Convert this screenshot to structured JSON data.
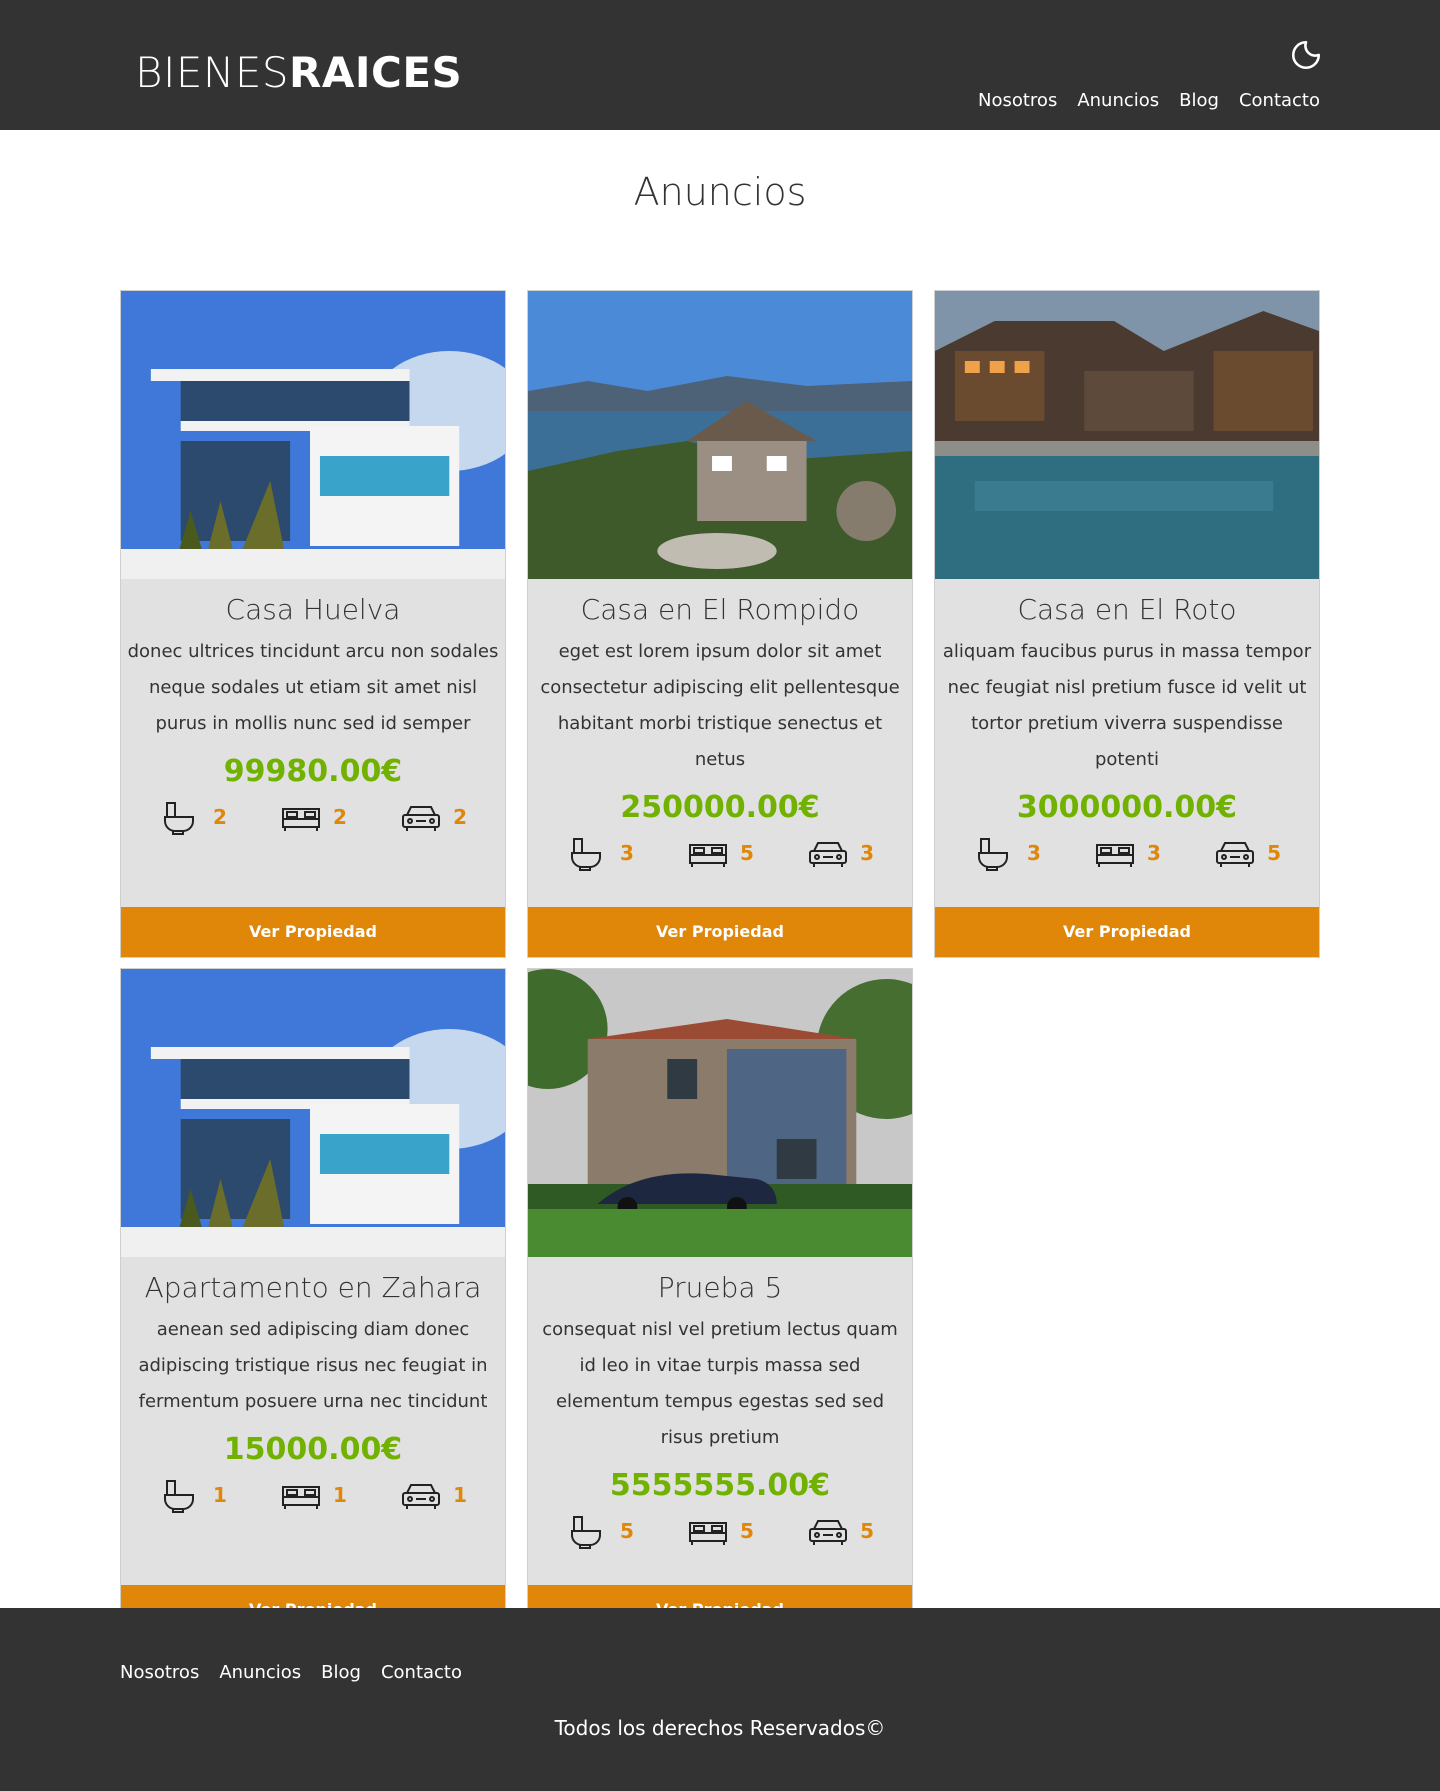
{
  "header": {
    "logo_light": "BIENES",
    "logo_bold": "RAICES",
    "nav": [
      {
        "label": "Nosotros"
      },
      {
        "label": "Anuncios"
      },
      {
        "label": "Blog"
      },
      {
        "label": "Contacto"
      }
    ]
  },
  "main": {
    "title": "Anuncios",
    "listings": [
      {
        "title": "Casa Huelva",
        "description": "donec ultrices tincidunt arcu non sodales neque sodales ut etiam sit amet nisl purus in mollis nunc sed id semper",
        "price": "99980.00€",
        "bathrooms": "2",
        "bedrooms": "2",
        "parking": "2",
        "button": "Ver Propiedad"
      },
      {
        "title": "Casa en El Rompido",
        "description": "eget est lorem ipsum dolor sit amet consectetur adipiscing elit pellentesque habitant morbi tristique senectus et netus",
        "price": "250000.00€",
        "bathrooms": "3",
        "bedrooms": "5",
        "parking": "3",
        "button": "Ver Propiedad"
      },
      {
        "title": "Casa en El Roto",
        "description": "aliquam faucibus purus in massa tempor nec feugiat nisl pretium fusce id velit ut tortor pretium viverra suspendisse potenti",
        "price": "3000000.00€",
        "bathrooms": "3",
        "bedrooms": "3",
        "parking": "5",
        "button": "Ver Propiedad"
      },
      {
        "title": "Apartamento en Zahara",
        "description": "aenean sed adipiscing diam donec adipiscing tristique risus nec feugiat in fermentum posuere urna nec tincidunt",
        "price": "15000.00€",
        "bathrooms": "1",
        "bedrooms": "1",
        "parking": "1",
        "button": "Ver Propiedad"
      },
      {
        "title": "Prueba 5",
        "description": "consequat nisl vel pretium lectus quam id leo in vitae turpis massa sed elementum tempus egestas sed sed risus pretium",
        "price": "5555555.00€",
        "bathrooms": "5",
        "bedrooms": "5",
        "parking": "5",
        "button": "Ver Propiedad"
      }
    ]
  },
  "footer": {
    "nav": [
      {
        "label": "Nosotros"
      },
      {
        "label": "Anuncios"
      },
      {
        "label": "Blog"
      },
      {
        "label": "Contacto"
      }
    ],
    "copyright": "Todos los derechos Reservados©"
  },
  "colors": {
    "header_bg": "#333333",
    "card_bg": "#e1e1e1",
    "price_green": "#71b100",
    "accent_orange": "#e08709"
  },
  "icons": {
    "dark_mode": "moon-icon",
    "bathroom": "toilet-icon",
    "bedroom": "bed-icon",
    "parking": "car-icon"
  }
}
